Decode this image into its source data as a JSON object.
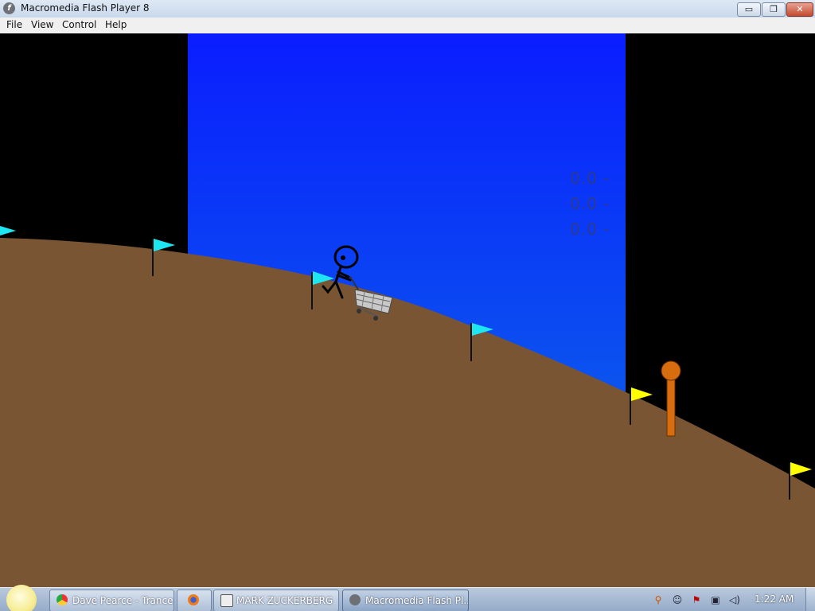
{
  "window": {
    "title": "Macromedia Flash Player 8",
    "buttons": {
      "minimize": "▭",
      "restore": "❐",
      "close": "✕"
    }
  },
  "menu": {
    "items": [
      "File",
      "View",
      "Control",
      "Help"
    ]
  },
  "game": {
    "hud": [
      "0.0 -",
      "0.0 -",
      "0.0 -"
    ],
    "colors": {
      "ground": "#7a5534",
      "sky_top": "#0a1dff",
      "sky_bottom": "#0b4cf0",
      "flag_cyan": "#1ee6f0",
      "flag_yellow": "#ffff00",
      "marker": "#d86d10"
    },
    "scene_elements": [
      "stick-figure",
      "shopping-cart",
      "flags",
      "distance-marker"
    ]
  },
  "taskbar": {
    "tasks": [
      {
        "label": "Dave Pearce - Trance...",
        "icon": "chrome-icon"
      },
      {
        "label": "",
        "icon": "firefox-icon"
      },
      {
        "label": "MARK ZUCKERBERG",
        "icon": "document-icon"
      },
      {
        "label": "Macromedia Flash Pl...",
        "icon": "flash-player-icon"
      }
    ],
    "clock": "1:22 AM",
    "tray_icons": [
      "search-icon",
      "messenger-icon",
      "flag-alert-icon",
      "network-icon",
      "volume-icon"
    ]
  }
}
